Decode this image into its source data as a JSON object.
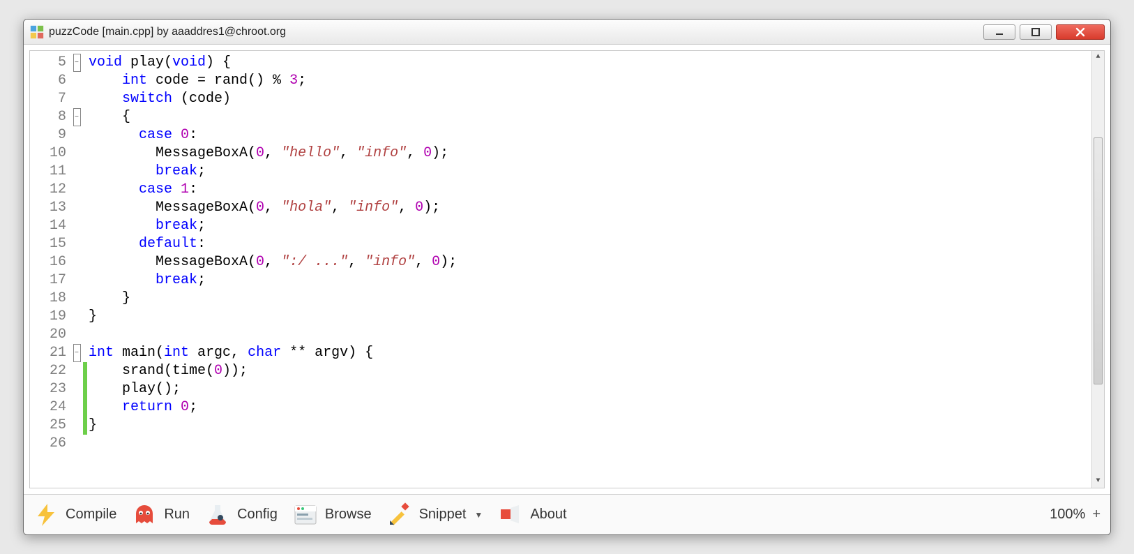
{
  "window": {
    "title": "puzzCode [main.cpp] by aaaddres1@chroot.org"
  },
  "editor": {
    "first_line": 5,
    "lines": [
      {
        "n": 5,
        "fold": "-",
        "changed": false,
        "tokens": [
          [
            "kw",
            "void"
          ],
          [
            "",
            " play("
          ],
          [
            "kw",
            "void"
          ],
          [
            "",
            ") {"
          ]
        ]
      },
      {
        "n": 6,
        "fold": "",
        "changed": false,
        "tokens": [
          [
            "",
            "    "
          ],
          [
            "kw",
            "int"
          ],
          [
            "",
            " code = rand() % "
          ],
          [
            "num",
            "3"
          ],
          [
            "",
            ";"
          ]
        ]
      },
      {
        "n": 7,
        "fold": "",
        "changed": false,
        "tokens": [
          [
            "",
            "    "
          ],
          [
            "kw",
            "switch"
          ],
          [
            "",
            " (code)"
          ]
        ]
      },
      {
        "n": 8,
        "fold": "-",
        "changed": false,
        "tokens": [
          [
            "",
            "    {"
          ]
        ]
      },
      {
        "n": 9,
        "fold": "",
        "changed": false,
        "tokens": [
          [
            "",
            "      "
          ],
          [
            "kw",
            "case"
          ],
          [
            "",
            " "
          ],
          [
            "num",
            "0"
          ],
          [
            "",
            ":"
          ]
        ]
      },
      {
        "n": 10,
        "fold": "",
        "changed": false,
        "tokens": [
          [
            "",
            "        MessageBoxA("
          ],
          [
            "num",
            "0"
          ],
          [
            "",
            ", "
          ],
          [
            "str",
            "\"hello\""
          ],
          [
            "",
            ", "
          ],
          [
            "str",
            "\"info\""
          ],
          [
            "",
            ", "
          ],
          [
            "num",
            "0"
          ],
          [
            "",
            ");"
          ]
        ]
      },
      {
        "n": 11,
        "fold": "",
        "changed": false,
        "tokens": [
          [
            "",
            "        "
          ],
          [
            "kw",
            "break"
          ],
          [
            "",
            ";"
          ]
        ]
      },
      {
        "n": 12,
        "fold": "",
        "changed": false,
        "tokens": [
          [
            "",
            "      "
          ],
          [
            "kw",
            "case"
          ],
          [
            "",
            " "
          ],
          [
            "num",
            "1"
          ],
          [
            "",
            ":"
          ]
        ]
      },
      {
        "n": 13,
        "fold": "",
        "changed": false,
        "tokens": [
          [
            "",
            "        MessageBoxA("
          ],
          [
            "num",
            "0"
          ],
          [
            "",
            ", "
          ],
          [
            "str",
            "\"hola\""
          ],
          [
            "",
            ", "
          ],
          [
            "str",
            "\"info\""
          ],
          [
            "",
            ", "
          ],
          [
            "num",
            "0"
          ],
          [
            "",
            ");"
          ]
        ]
      },
      {
        "n": 14,
        "fold": "",
        "changed": false,
        "tokens": [
          [
            "",
            "        "
          ],
          [
            "kw",
            "break"
          ],
          [
            "",
            ";"
          ]
        ]
      },
      {
        "n": 15,
        "fold": "",
        "changed": false,
        "tokens": [
          [
            "",
            "      "
          ],
          [
            "kw",
            "default"
          ],
          [
            "",
            ":"
          ]
        ]
      },
      {
        "n": 16,
        "fold": "",
        "changed": false,
        "tokens": [
          [
            "",
            "        MessageBoxA("
          ],
          [
            "num",
            "0"
          ],
          [
            "",
            ", "
          ],
          [
            "str",
            "\":/ ...\""
          ],
          [
            "",
            ", "
          ],
          [
            "str",
            "\"info\""
          ],
          [
            "",
            ", "
          ],
          [
            "num",
            "0"
          ],
          [
            "",
            ");"
          ]
        ]
      },
      {
        "n": 17,
        "fold": "",
        "changed": false,
        "tokens": [
          [
            "",
            "        "
          ],
          [
            "kw",
            "break"
          ],
          [
            "",
            ";"
          ]
        ]
      },
      {
        "n": 18,
        "fold": "",
        "changed": false,
        "tokens": [
          [
            "",
            "    }"
          ]
        ]
      },
      {
        "n": 19,
        "fold": "",
        "changed": false,
        "tokens": [
          [
            "",
            "}"
          ]
        ]
      },
      {
        "n": 20,
        "fold": "",
        "changed": false,
        "tokens": [
          [
            "",
            ""
          ]
        ]
      },
      {
        "n": 21,
        "fold": "-",
        "changed": false,
        "tokens": [
          [
            "kw",
            "int"
          ],
          [
            "",
            " main("
          ],
          [
            "kw",
            "int"
          ],
          [
            "",
            " argc, "
          ],
          [
            "kw",
            "char"
          ],
          [
            "",
            " ** argv) {"
          ]
        ]
      },
      {
        "n": 22,
        "fold": "",
        "changed": true,
        "tokens": [
          [
            "",
            "    srand(time("
          ],
          [
            "num",
            "0"
          ],
          [
            "",
            "));"
          ]
        ]
      },
      {
        "n": 23,
        "fold": "",
        "changed": true,
        "tokens": [
          [
            "",
            "    play();"
          ]
        ]
      },
      {
        "n": 24,
        "fold": "",
        "changed": true,
        "tokens": [
          [
            "",
            "    "
          ],
          [
            "kw",
            "return"
          ],
          [
            "",
            " "
          ],
          [
            "num",
            "0"
          ],
          [
            "",
            ";"
          ]
        ]
      },
      {
        "n": 25,
        "fold": "",
        "changed": true,
        "tokens": [
          [
            "",
            "}"
          ]
        ]
      },
      {
        "n": 26,
        "fold": "",
        "changed": false,
        "tokens": [
          [
            "",
            ""
          ]
        ]
      }
    ]
  },
  "toolbar": {
    "compile": "Compile",
    "run": "Run",
    "config": "Config",
    "browse": "Browse",
    "snippet": "Snippet",
    "about": "About",
    "zoom": "100%",
    "plus": "+"
  }
}
